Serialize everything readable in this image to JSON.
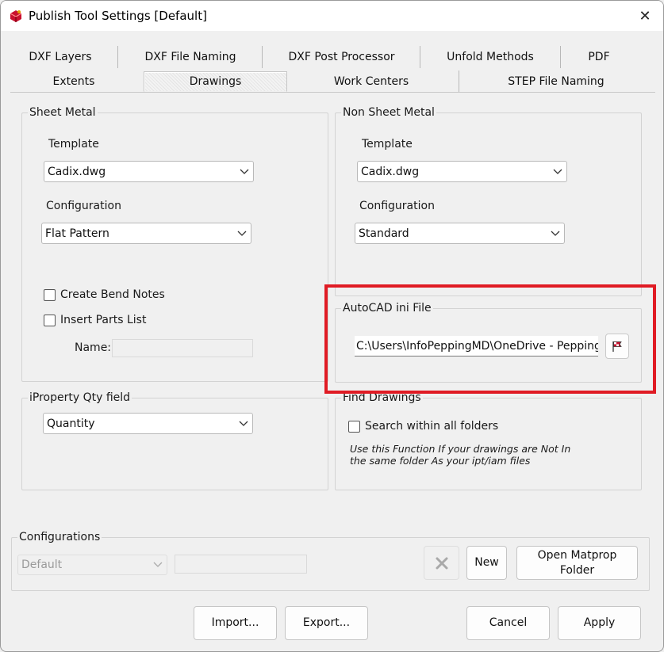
{
  "window": {
    "title": "Publish Tool Settings  [Default]",
    "app_icon": "publish-tool-app-icon",
    "close_glyph": "✕"
  },
  "tabs": {
    "row1": [
      "DXF Layers",
      "DXF File Naming",
      "DXF Post Processor",
      "Unfold Methods",
      "PDF"
    ],
    "row2": [
      "Extents",
      "Drawings",
      "Work Centers",
      "STEP File Naming"
    ],
    "active": "Drawings"
  },
  "sheet_metal": {
    "title": "Sheet Metal",
    "template_label": "Template",
    "template_value": "Cadix.dwg",
    "configuration_label": "Configuration",
    "configuration_value": "Flat Pattern",
    "create_bend_notes": {
      "label": "Create Bend Notes",
      "checked": false
    },
    "insert_parts_list": {
      "label": "Insert Parts List",
      "checked": false
    },
    "name_label": "Name:",
    "name_value": ""
  },
  "non_sheet_metal": {
    "title": "Non Sheet Metal",
    "template_label": "Template",
    "template_value": "Cadix.dwg",
    "configuration_label": "Configuration",
    "configuration_value": "Standard"
  },
  "autocad_ini": {
    "title": "AutoCAD ini File",
    "path": "C:\\Users\\InfoPeppingMD\\OneDrive - Pepping",
    "browse_icon": "flag-icon",
    "highlight_color": "#e01b24"
  },
  "iproperty": {
    "title": "iProperty Qty field",
    "value": "Quantity"
  },
  "find_drawings": {
    "title": "Find Drawings",
    "search_all": {
      "label": "Search within all folders",
      "checked": false
    },
    "note_line1": "Use this Function If your drawings are Not In",
    "note_line2": "the same folder As your ipt/iam files"
  },
  "configurations": {
    "title": "Configurations",
    "selected": "Default",
    "name_value": "",
    "delete_icon": "x-icon",
    "new_label": "New",
    "open_matprop_line1": "Open Matprop",
    "open_matprop_line2": "Folder"
  },
  "footer": {
    "import_label": "Import...",
    "export_label": "Export...",
    "cancel_label": "Cancel",
    "apply_label": "Apply"
  },
  "colors": {
    "window_bg": "#f0f0f0",
    "accent_red": "#e01b24"
  }
}
